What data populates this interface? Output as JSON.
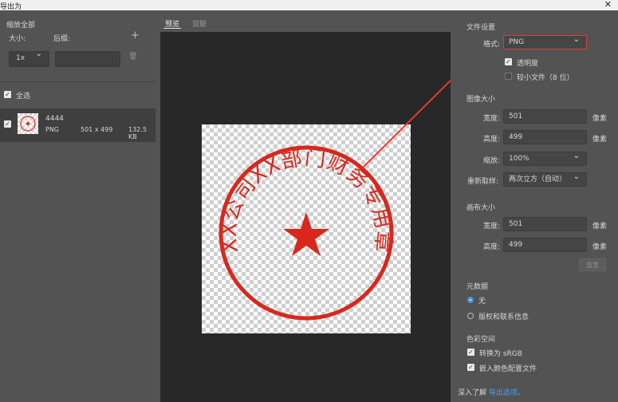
{
  "window": {
    "title": "导出为",
    "close_glyph": "✕"
  },
  "left": {
    "scale_all": "缩放全部",
    "size_label": "大小:",
    "suffix_label": "后缀:",
    "add_glyph": "+",
    "scale_value": "1x",
    "delete_glyph": "🗑",
    "select_all": "全选",
    "asset": {
      "name": "4444",
      "format": "PNG",
      "dimensions": "501 x 499",
      "filesize": "132.5 KB"
    }
  },
  "tabs": [
    "预览",
    "双联"
  ],
  "right": {
    "file_settings": "文件设置",
    "format_label": "格式:",
    "format_value": "PNG",
    "transparency": "透明度",
    "smaller_file": "较小文件（8 位）",
    "image_size": "图像大小",
    "width_label": "宽度:",
    "width_value": "501",
    "height_label": "高度:",
    "height_value": "499",
    "unit": "像素",
    "scale_label": "缩放:",
    "scale_value": "100%",
    "resample_label": "重新取样:",
    "resample_value": "两次立方（自动）",
    "canvas_size": "画布大小",
    "canvas_width": "501",
    "canvas_height": "499",
    "reset": "重置",
    "metadata": "元数据",
    "meta_none": "无",
    "meta_copyright": "版权和联系信息",
    "color_space": "色彩空间",
    "convert_srgb": "转换为 sRGB",
    "embed_profile": "嵌入颜色配置文件",
    "learn_prefix": "深入了解",
    "learn_link": "导出选项。"
  },
  "stamp": {
    "text": "XX公司XX部门财务专用章",
    "color": "#d8281e"
  },
  "colors": {
    "accent_red": "#e03a3a",
    "radio_blue": "#4a8fe0"
  }
}
